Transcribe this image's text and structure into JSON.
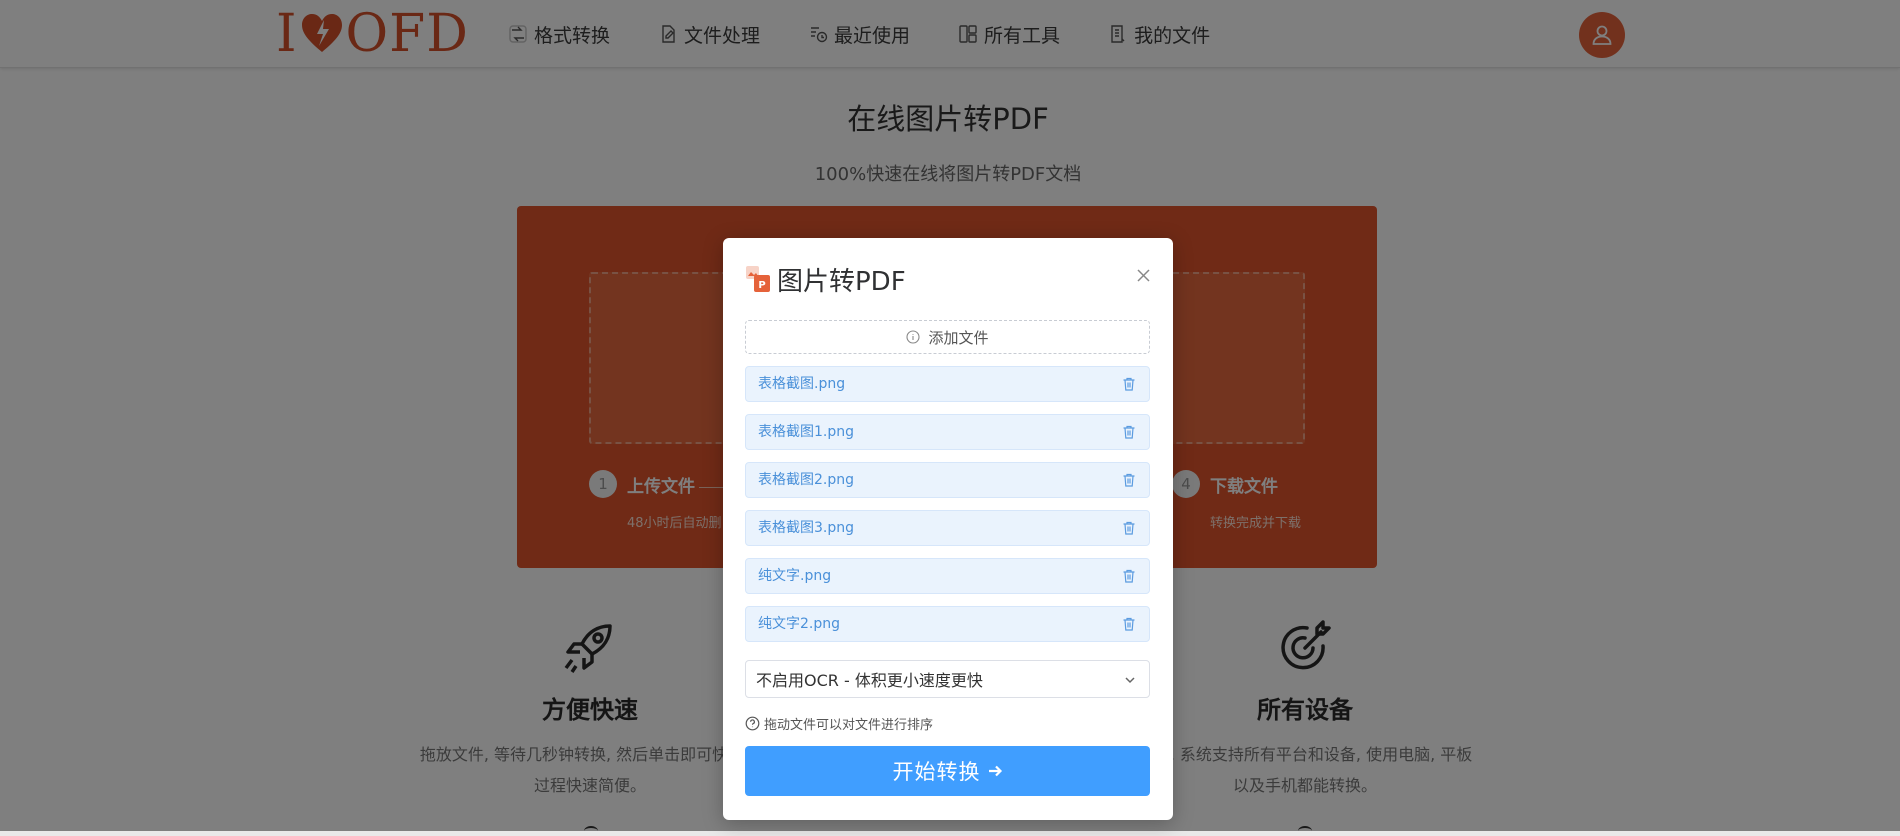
{
  "header": {
    "logo": {
      "prefix": "I",
      "suffix": "OFD"
    },
    "nav": [
      {
        "label": "格式转换",
        "icon": "convert-icon"
      },
      {
        "label": "文件处理",
        "icon": "file-edit-icon"
      },
      {
        "label": "最近使用",
        "icon": "history-icon"
      },
      {
        "label": "所有工具",
        "icon": "grid-icon"
      },
      {
        "label": "我的文件",
        "icon": "my-files-icon"
      }
    ],
    "avatar_icon": "user-icon"
  },
  "page": {
    "title": "在线图片转PDF",
    "subtitle": "100%快速在线将图片转PDF文档"
  },
  "steps": [
    {
      "num": "1",
      "title": "上传文件",
      "desc": "48小时后自动删"
    },
    {
      "num": "4",
      "title": "下载文件",
      "desc": "转换完成并下载"
    }
  ],
  "features": [
    {
      "icon": "rocket-icon",
      "title": "方便快速",
      "desc_line1": "拖放文件, 等待几秒钟转换, 然后单击即可快速下",
      "desc_line2": "过程快速简便。"
    },
    {
      "icon": "target-icon",
      "title": "所有设备",
      "desc_line1": "览器, 系统支持所有平台和设备, 使用电脑, 平板",
      "desc_line2": "以及手机都能转换。"
    }
  ],
  "modal": {
    "title": "图片转PDF",
    "app_icon": "image-to-pdf-icon",
    "add_file_label": "添加文件",
    "files": [
      "表格截图.png",
      "表格截图1.png",
      "表格截图2.png",
      "表格截图3.png",
      "纯文字.png",
      "纯文字2.png"
    ],
    "ocr_option": "不启用OCR - 体积更小速度更快",
    "hint": "拖动文件可以对文件进行排序",
    "start_label": "开始转换"
  },
  "colors": {
    "brand": "#d4502a",
    "panel": "#e1552d",
    "primary_button": "#409eff",
    "file_item_bg": "#eaf3fd",
    "file_item_text": "#4a90d9"
  }
}
